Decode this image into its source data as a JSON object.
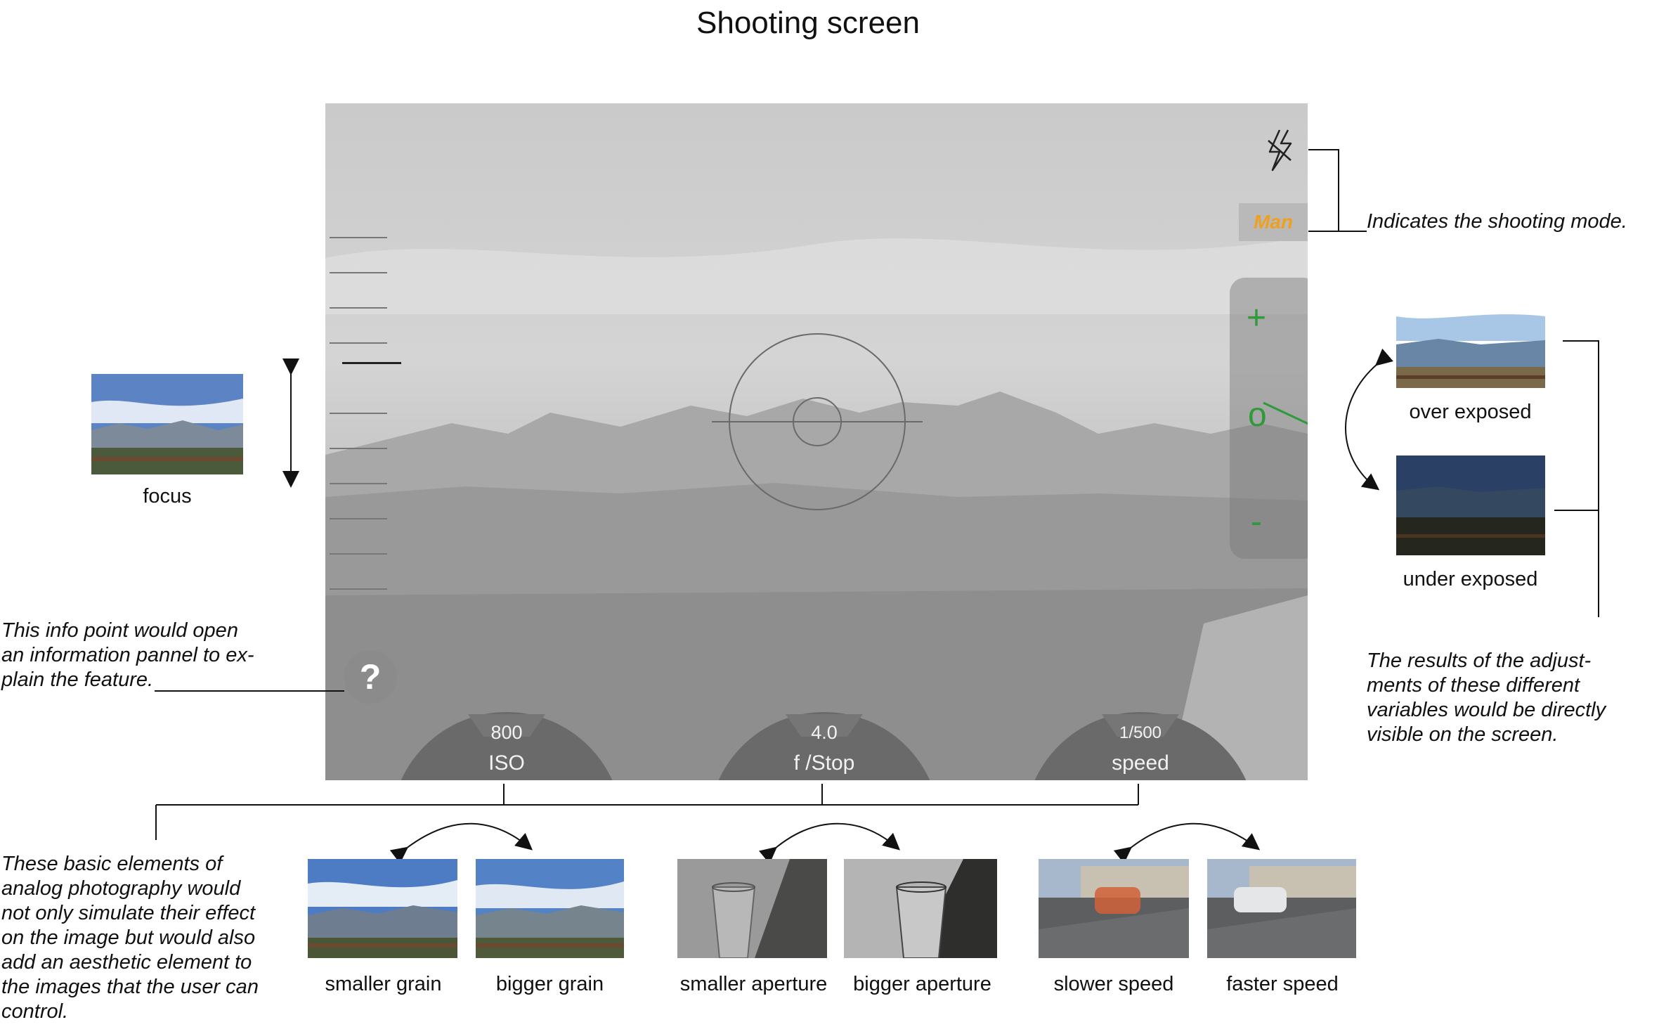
{
  "title": "Shooting screen",
  "viewfinder": {
    "mode_label": "Man",
    "help_glyph": "?",
    "exposure": {
      "plus": "+",
      "zero": "o",
      "minus": "-"
    },
    "controls": [
      {
        "value": "800",
        "label": "ISO"
      },
      {
        "value": "4.0",
        "label": "f /Stop"
      },
      {
        "value": "1/500",
        "label": "speed"
      }
    ],
    "icons": {
      "flash": "flash-off-icon",
      "target": "focus-reticle-icon",
      "help": "help-icon"
    },
    "colors": {
      "mode": "#f0a020",
      "exposure": "#2e9a3a"
    }
  },
  "annotations": {
    "focus": "focus",
    "mode_note": "Indicates the shooting mode.",
    "info_note": [
      "This info point would open",
      "an information pannel to ex-",
      "plain the feature."
    ],
    "exposure_note": [
      "The results of the adjust-",
      "ments of these different",
      "variables would be directly",
      "visible on the screen."
    ],
    "basics_note": [
      "These basic elements of",
      "analog photography would",
      "not only simulate their effect",
      "on the image but would also",
      "add an aesthetic element to",
      "the images that the user can",
      "control."
    ]
  },
  "exposure_examples": {
    "over": "over exposed",
    "under": "under exposed"
  },
  "examples": [
    {
      "caption": "smaller grain"
    },
    {
      "caption": "bigger grain"
    },
    {
      "caption": "smaller aperture"
    },
    {
      "caption": "bigger aperture"
    },
    {
      "caption": "slower speed"
    },
    {
      "caption": "faster speed"
    }
  ]
}
